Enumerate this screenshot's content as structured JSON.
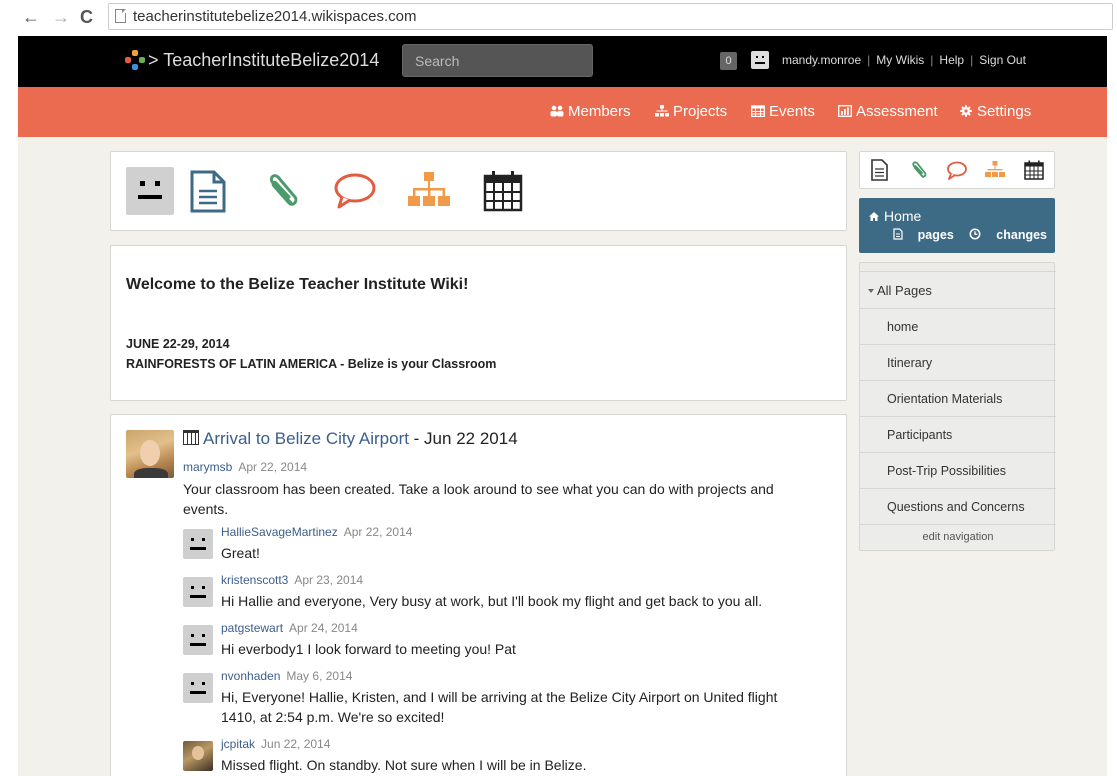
{
  "browser": {
    "back": "←",
    "forward": "→",
    "reload": "C",
    "url": "teacherinstitutebelize2014.wikispaces.com"
  },
  "header": {
    "site_title": "> TeacherInstituteBelize2014",
    "search_placeholder": "Search",
    "notification_count": "0",
    "username": "mandy.monroe",
    "my_wikis": "My Wikis",
    "help": "Help",
    "sign_out": "Sign Out",
    "separator": "|"
  },
  "nav": {
    "members": "Members",
    "projects": "Projects",
    "events": "Events",
    "assessment": "Assessment",
    "settings": "Settings"
  },
  "toolbar_icons": [
    "avatar-icon",
    "page-icon",
    "paperclip-icon",
    "comment-icon",
    "projects-icon",
    "calendar-icon"
  ],
  "welcome": {
    "heading": "Welcome to the Belize Teacher Institute Wiki!",
    "date": "JUNE 22-29, 2014",
    "subtitle": "RAINFORESTS OF LATIN AMERICA - Belize is your Classroom"
  },
  "event": {
    "title_link": "Arrival to Belize City Airport",
    "title_rest": " - Jun 22 2014",
    "author": "marymsb",
    "date": "Apr 22, 2014",
    "body": "Your classroom has been created. Take a look around to see what you can do with projects and events.",
    "replies": [
      {
        "author": "HallieSavageMartinez",
        "date": "Apr 22, 2014",
        "body": "Great!"
      },
      {
        "author": "kristenscott3",
        "date": "Apr 23, 2014",
        "body": "Hi Hallie and everyone, Very busy at work, but I'll book my flight and get back to you all."
      },
      {
        "author": "patgstewart",
        "date": "Apr 24, 2014",
        "body": "Hi everbody1 I look forward to meeting you! Pat"
      },
      {
        "author": "nvonhaden",
        "date": "May 6, 2014",
        "body": "Hi, Everyone! Hallie, Kristen, and I will be arriving at the Belize City Airport on United flight 1410, at 2:54 p.m. We're so excited!"
      },
      {
        "author": "jcpitak",
        "date": "Jun 22, 2014",
        "body": "Missed flight. On standby. Not sure when I will be in Belize."
      }
    ]
  },
  "sidebar": {
    "home_label": "Home",
    "pages_link": "pages",
    "changes_link": "changes",
    "all_pages": "All Pages",
    "items": [
      "home",
      "Itinerary",
      "Orientation Materials",
      "Participants",
      "Post-Trip Possibilities",
      "Questions and Concerns"
    ],
    "edit_navigation": "edit navigation"
  },
  "colors": {
    "nav_orange": "#ea6b4f",
    "sidebar_blue": "#3d6a85",
    "link_blue": "#3b5e8c",
    "paperclip_green": "#4a9a6a",
    "comment_red": "#e25c3f",
    "projects_orange": "#f09a4a"
  }
}
